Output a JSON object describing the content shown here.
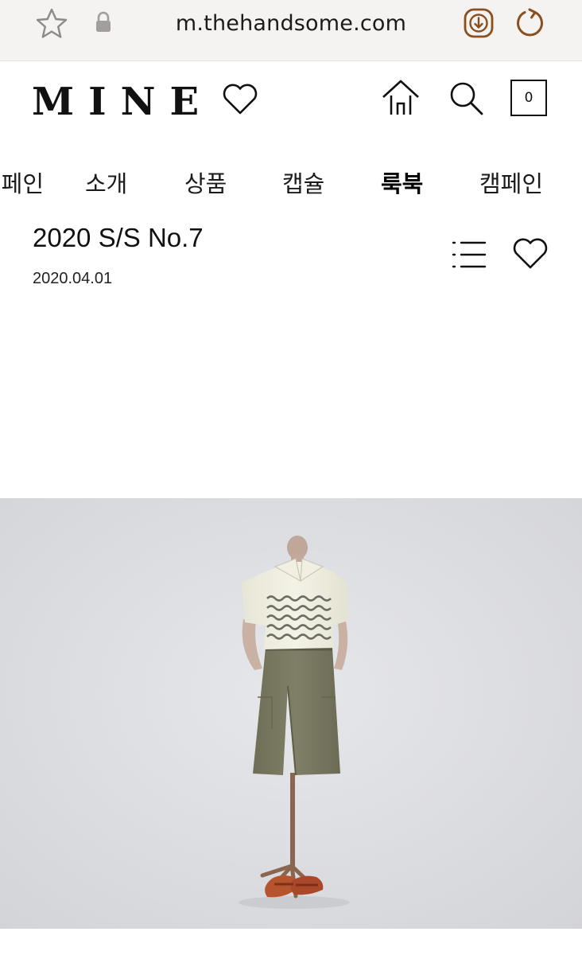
{
  "browser": {
    "url": "m.thehandsome.com",
    "icons": [
      "star-icon",
      "lock-icon",
      "download-icon",
      "reload-icon"
    ]
  },
  "header": {
    "logo": "MINE",
    "logo_icon": "heart-outline-icon",
    "home_icon": "home-icon",
    "search_icon": "search-icon",
    "cart_count": "0"
  },
  "nav": {
    "items": [
      {
        "label": "캠페인"
      },
      {
        "label": "소개"
      },
      {
        "label": "상품"
      },
      {
        "label": "캡슐"
      },
      {
        "label": "룩북"
      },
      {
        "label": "캠페인"
      }
    ],
    "active_index": 4
  },
  "article": {
    "title": "2020 S/S No.7",
    "date": "2020.04.01",
    "list_icon": "list-icon",
    "like_icon": "heart-outline-icon"
  },
  "lookbook": {
    "image": "mannequin wearing cream knit polo with wavy stripes, khaki culottes, brown sandals",
    "colors": {
      "background": "#dcdde0",
      "knit": "#efeee0",
      "stripe": "#6c6e64",
      "pants": "#7b7a62",
      "stand": "#8a6650",
      "sandal": "#b5542d"
    }
  }
}
